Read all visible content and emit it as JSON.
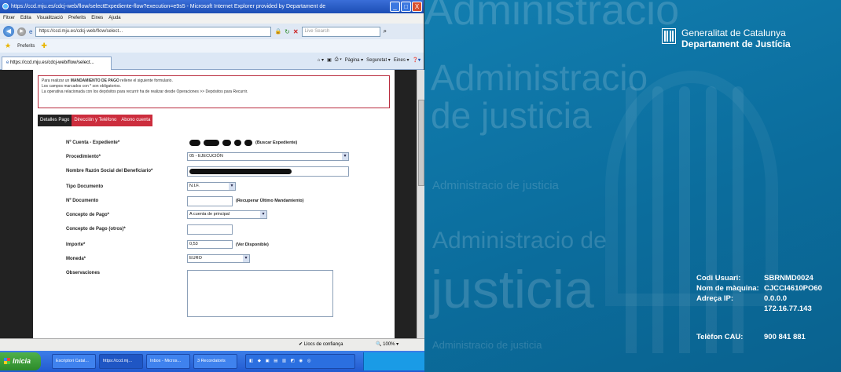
{
  "browser": {
    "title": "https://ccd.mju.es/cdcj-web/flow/selectExpediente-flow?execution=e9s5 - Microsoft Internet Explorer provided by Departament de",
    "window_buttons": [
      "_",
      "□",
      "X"
    ],
    "menu": [
      "Fitxer",
      "Edita",
      "Visualització",
      "Preferits",
      "Eines",
      "Ajuda"
    ],
    "address": "https://ccd.mju.es/cdcj-web/flow/select...",
    "search_placeholder": "Live Search",
    "favorites_label": "Preferits",
    "tab_label": "https://ccd.mju.es/cdcj-web/flow/select...",
    "command_bar": [
      "Pàgina ▾",
      "Seguretat ▾",
      "Eines ▾"
    ],
    "status_trust": "Llocs de confiança",
    "status_zoom": "100%"
  },
  "page": {
    "notice": {
      "line1_pre": "Para realizar un",
      "line1_bold": "MANDAMIENTO DE PAGO",
      "line1_post": "rellene el siguiente formulario.",
      "line2": "Los campos marcados con * son obligatorios.",
      "line3": "La operativa relacionada con los depósitos para recurrir ha de realizar desde Operaciones >> Depósitos para Recurrir."
    },
    "tabs": [
      "Detalles Pago",
      "Dirección y Teléfono",
      "Abono cuenta"
    ],
    "fields": {
      "cuenta_label": "Nº Cuenta - Expediente*",
      "cuenta_link": "(Buscar Expediente)",
      "procedimiento_label": "Procedimiento*",
      "procedimiento_value": "05 - EJECUCIÓN",
      "nombre_label": "Nombre Razón Social del Beneficiario*",
      "tipo_doc_label": "Tipo Documento",
      "tipo_doc_value": "N.I.F.",
      "num_doc_label": "Nº Documento",
      "num_doc_link": "(Recuperar Último Mandamiento)",
      "concepto_label": "Concepto de Pago*",
      "concepto_value": "A cuenta de principal",
      "concepto_otros_label": "Concepto de Pago (otros)*",
      "importe_label": "Importe*",
      "importe_value": "0,53",
      "importe_link": "(Ver Disponible)",
      "moneda_label": "Moneda*",
      "moneda_value": "EURO",
      "observaciones_label": "Observaciones"
    }
  },
  "taskbar": {
    "start": "Inicia",
    "items": [
      "Escriptori Catal...",
      "https://ccd.mj...",
      "Inbox - Micros...",
      "3 Recordatoris"
    ]
  },
  "login_screen": {
    "brand_line1": "Generalitat de Catalunya",
    "brand_line2": "Departament de Justícia",
    "watermarks": [
      "Administracio",
      "Administracio",
      "de justicia",
      "Administracio de justicia",
      "Administracio de",
      "justicia",
      "Administracio de justicia"
    ],
    "info": [
      {
        "label": "Codi Usuari:",
        "value": "SBRNMD0024"
      },
      {
        "label": "Nom de màquina:",
        "value": "CJCCI4610PO60"
      },
      {
        "label": "Adreça IP:",
        "value": "0.0.0.0"
      },
      {
        "label": "",
        "value": "172.16.77.143"
      },
      {
        "label": "Telèfon CAU:",
        "value": "900 841 881"
      }
    ]
  },
  "colors": {
    "brand_blue": "#0b6d9d",
    "tab_red": "#cc2d3d",
    "notice_border": "#b92c3e"
  }
}
